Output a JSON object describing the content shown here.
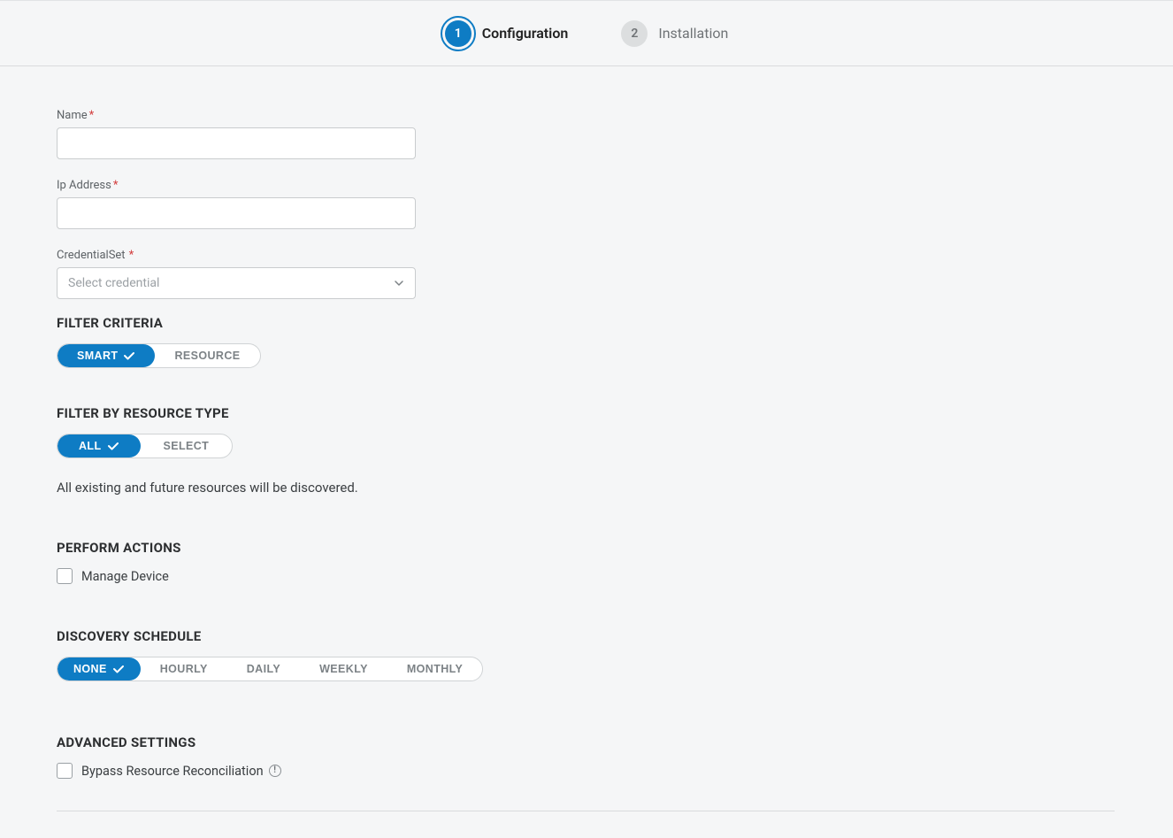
{
  "stepper": {
    "steps": [
      {
        "num": "1",
        "label": "Configuration",
        "active": true
      },
      {
        "num": "2",
        "label": "Installation",
        "active": false
      }
    ]
  },
  "fields": {
    "name": {
      "label": "Name",
      "value": ""
    },
    "ip": {
      "label": "Ip Address",
      "value": ""
    },
    "cred": {
      "label": "CredentialSet",
      "placeholder": "Select credential"
    }
  },
  "filterCriteria": {
    "heading": "FILTER CRITERIA",
    "options": [
      "SMART",
      "RESOURCE"
    ],
    "selected": "SMART"
  },
  "filterResourceType": {
    "heading": "FILTER BY RESOURCE TYPE",
    "options": [
      "ALL",
      "SELECT"
    ],
    "selected": "ALL",
    "hint": "All existing and future resources will be discovered."
  },
  "performActions": {
    "heading": "PERFORM ACTIONS",
    "manageDevice": {
      "label": "Manage Device",
      "checked": false
    }
  },
  "discoverySchedule": {
    "heading": "DISCOVERY SCHEDULE",
    "options": [
      "NONE",
      "HOURLY",
      "DAILY",
      "WEEKLY",
      "MONTHLY"
    ],
    "selected": "NONE"
  },
  "advanced": {
    "heading": "ADVANCED SETTINGS",
    "bypass": {
      "label": "Bypass Resource Reconciliation",
      "checked": false
    }
  }
}
